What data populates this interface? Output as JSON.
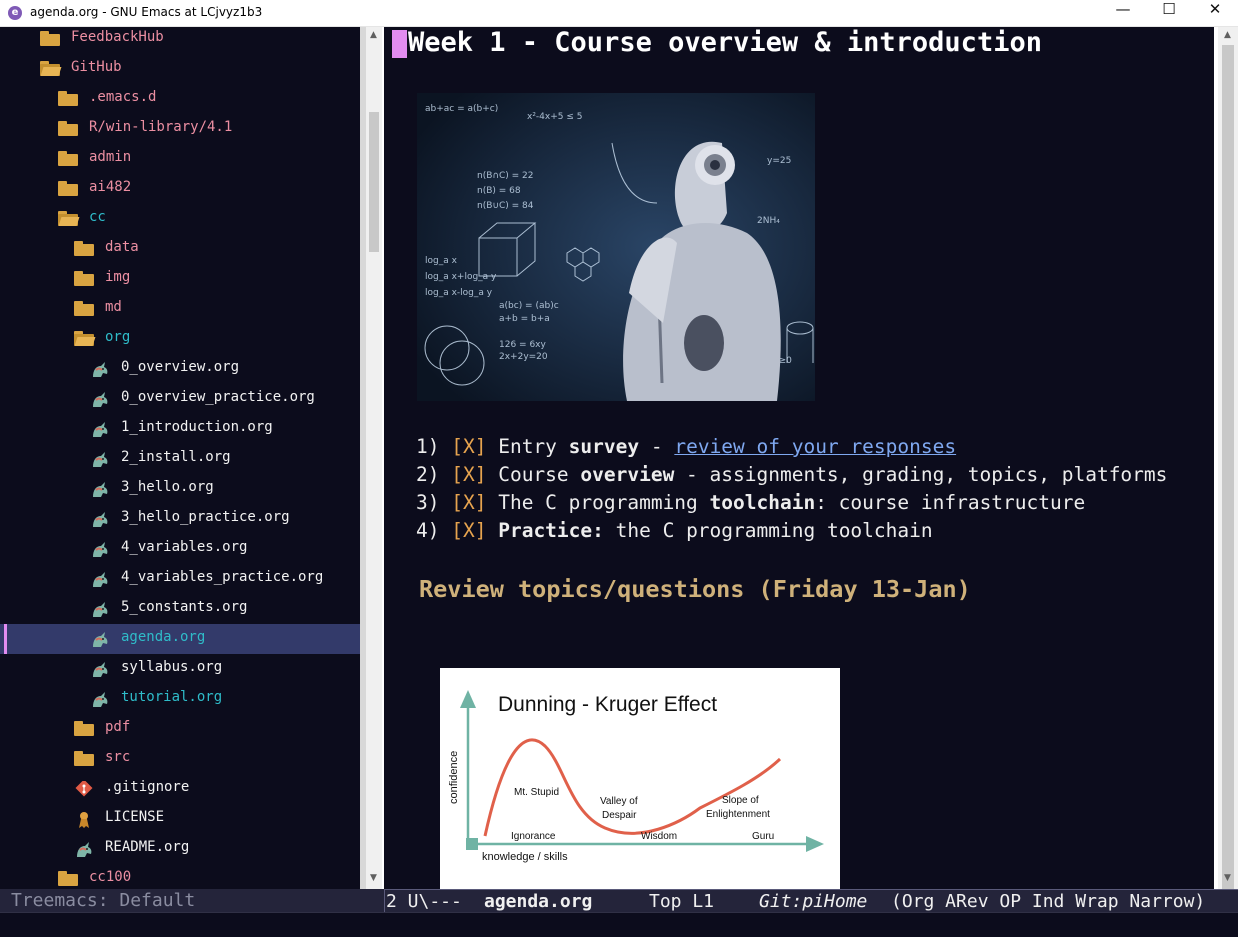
{
  "window": {
    "title": "agenda.org - GNU Emacs at LCjvyz1b3",
    "icon_letter": "e",
    "minimize": "—",
    "maximize": "☐",
    "close": "✕"
  },
  "sidebar": {
    "items": [
      {
        "label": "FeedbackHub",
        "kind": "folder",
        "open": false,
        "depth": 1,
        "color": "folder"
      },
      {
        "label": "GitHub",
        "kind": "folder",
        "open": true,
        "depth": 1,
        "color": "folder"
      },
      {
        "label": ".emacs.d",
        "kind": "folder",
        "open": false,
        "depth": 2,
        "color": "folder"
      },
      {
        "label": "R/win-library/4.1",
        "kind": "folder",
        "open": false,
        "depth": 2,
        "color": "folder"
      },
      {
        "label": "admin",
        "kind": "folder",
        "open": false,
        "depth": 2,
        "color": "folder"
      },
      {
        "label": "ai482",
        "kind": "folder",
        "open": false,
        "depth": 2,
        "color": "folder"
      },
      {
        "label": "cc",
        "kind": "folder",
        "open": true,
        "depth": 2,
        "color": "cyan"
      },
      {
        "label": "data",
        "kind": "folder",
        "open": false,
        "depth": 3,
        "color": "folder"
      },
      {
        "label": "img",
        "kind": "folder",
        "open": false,
        "depth": 3,
        "color": "folder"
      },
      {
        "label": "md",
        "kind": "folder",
        "open": false,
        "depth": 3,
        "color": "folder"
      },
      {
        "label": "org",
        "kind": "folder",
        "open": true,
        "depth": 3,
        "color": "cyan"
      },
      {
        "label": "0_overview.org",
        "kind": "org",
        "depth": 4,
        "color": "file"
      },
      {
        "label": "0_overview_practice.org",
        "kind": "org",
        "depth": 4,
        "color": "file"
      },
      {
        "label": "1_introduction.org",
        "kind": "org",
        "depth": 4,
        "color": "file"
      },
      {
        "label": "2_install.org",
        "kind": "org",
        "depth": 4,
        "color": "file"
      },
      {
        "label": "3_hello.org",
        "kind": "org",
        "depth": 4,
        "color": "file"
      },
      {
        "label": "3_hello_practice.org",
        "kind": "org",
        "depth": 4,
        "color": "file"
      },
      {
        "label": "4_variables.org",
        "kind": "org",
        "depth": 4,
        "color": "file"
      },
      {
        "label": "4_variables_practice.org",
        "kind": "org",
        "depth": 4,
        "color": "file"
      },
      {
        "label": "5_constants.org",
        "kind": "org",
        "depth": 4,
        "color": "file"
      },
      {
        "label": "agenda.org",
        "kind": "org",
        "depth": 4,
        "color": "cyan",
        "selected": true
      },
      {
        "label": "syllabus.org",
        "kind": "org",
        "depth": 4,
        "color": "file"
      },
      {
        "label": "tutorial.org",
        "kind": "org",
        "depth": 4,
        "color": "cyan"
      },
      {
        "label": "pdf",
        "kind": "folder",
        "open": false,
        "depth": 3,
        "color": "folder"
      },
      {
        "label": "src",
        "kind": "folder",
        "open": false,
        "depth": 3,
        "color": "folder"
      },
      {
        "label": ".gitignore",
        "kind": "git",
        "depth": 3,
        "color": "file"
      },
      {
        "label": "LICENSE",
        "kind": "license",
        "depth": 3,
        "color": "file"
      },
      {
        "label": "README.org",
        "kind": "org",
        "depth": 3,
        "color": "file"
      },
      {
        "label": "cc100",
        "kind": "folder",
        "open": false,
        "depth": 2,
        "color": "folder"
      }
    ]
  },
  "editor": {
    "heading": "Week 1 - Course overview & introduction",
    "todos": [
      {
        "num": "1)",
        "box": "[X]",
        "parts": [
          {
            "t": " Entry "
          },
          {
            "t": "survey",
            "b": true
          },
          {
            "t": " - "
          },
          {
            "t": "review of your responses",
            "link": true
          }
        ]
      },
      {
        "num": "2)",
        "box": "[X]",
        "parts": [
          {
            "t": " Course "
          },
          {
            "t": "overview",
            "b": true
          },
          {
            "t": " - assignments, grading, topics, platforms"
          }
        ]
      },
      {
        "num": "3)",
        "box": "[X]",
        "parts": [
          {
            "t": " The C programming "
          },
          {
            "t": "toolchain",
            "b": true
          },
          {
            "t": ": course infrastructure"
          }
        ]
      },
      {
        "num": "4)",
        "box": "[X]",
        "parts": [
          {
            "t": " "
          },
          {
            "t": "Practice:",
            "b": true
          },
          {
            "t": " the C programming toolchain"
          }
        ]
      }
    ],
    "subheading": "Review topics/questions (Friday 13-Jan)",
    "dk_figure": {
      "title": "Dunning - Kruger Effect",
      "ylabel": "confidence",
      "xlabel": "knowledge / skills",
      "peak_label": "Mt. Stupid",
      "valley_label_1": "Valley of",
      "valley_label_2": "Despair",
      "slope_label_1": "Slope of",
      "slope_label_2": "Enlightenment",
      "stage_ignorance": "Ignorance",
      "stage_wisdom": "Wisdom",
      "stage_guru": "Guru"
    }
  },
  "modeline": {
    "treemacs": "Treemacs: Default",
    "window_num": "2 U\\---",
    "buffer": "agenda.org",
    "position": "Top L1",
    "git": "Git:piHome",
    "modes": "(Org ARev OP Ind Wrap Narrow)"
  },
  "colors": {
    "background": "#0c0c1c",
    "accent_pink": "#e28cf0",
    "folder": "#d9a441",
    "checkbox": "#e7a44f",
    "subheading": "#cfb17a",
    "link": "#7fa8f0"
  }
}
